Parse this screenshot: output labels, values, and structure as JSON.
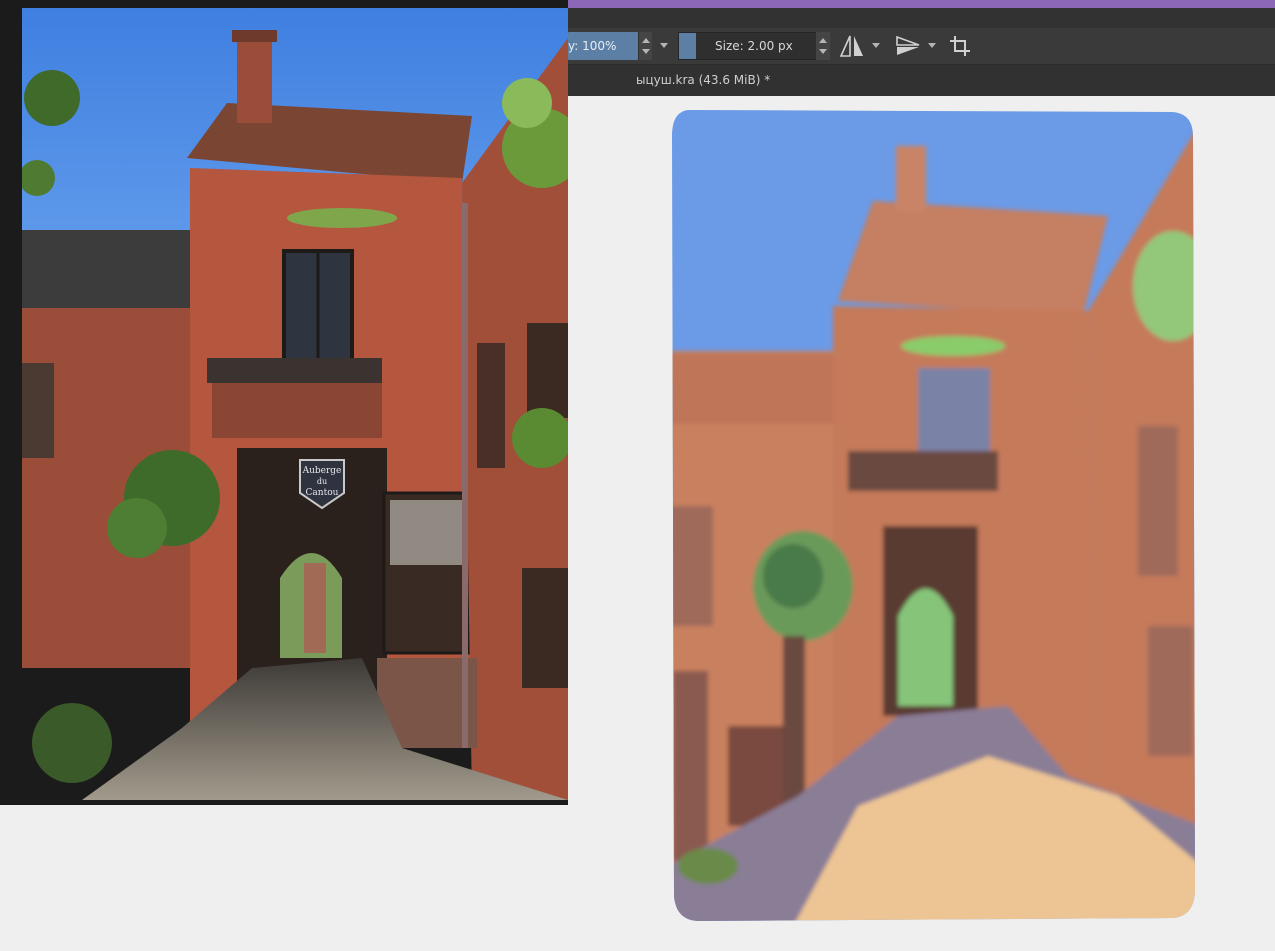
{
  "toolbar": {
    "opacity_text": "y: 100%",
    "size_text": "Size: 2.00 px",
    "size_fraction": 0.12
  },
  "tabs": {
    "document_title": "ыцуш.kra (43.6 MiB) *"
  },
  "reference_photo": {
    "sign_line1": "Auberge",
    "sign_line2": "du",
    "sign_line3": "Cantou"
  },
  "colors": {
    "accent": "#8c67b8",
    "sky": "#4f8fe6",
    "stone": "#b5563f",
    "paint_sky": "#6b9ae6",
    "paint_wall": "#c9805f",
    "paint_ground": "#edc594",
    "paint_shadow": "#8a7d96"
  },
  "icons": {
    "mirror_horizontal": "mirror-horizontal-icon",
    "mirror_vertical": "mirror-vertical-icon",
    "crop": "crop-icon"
  }
}
